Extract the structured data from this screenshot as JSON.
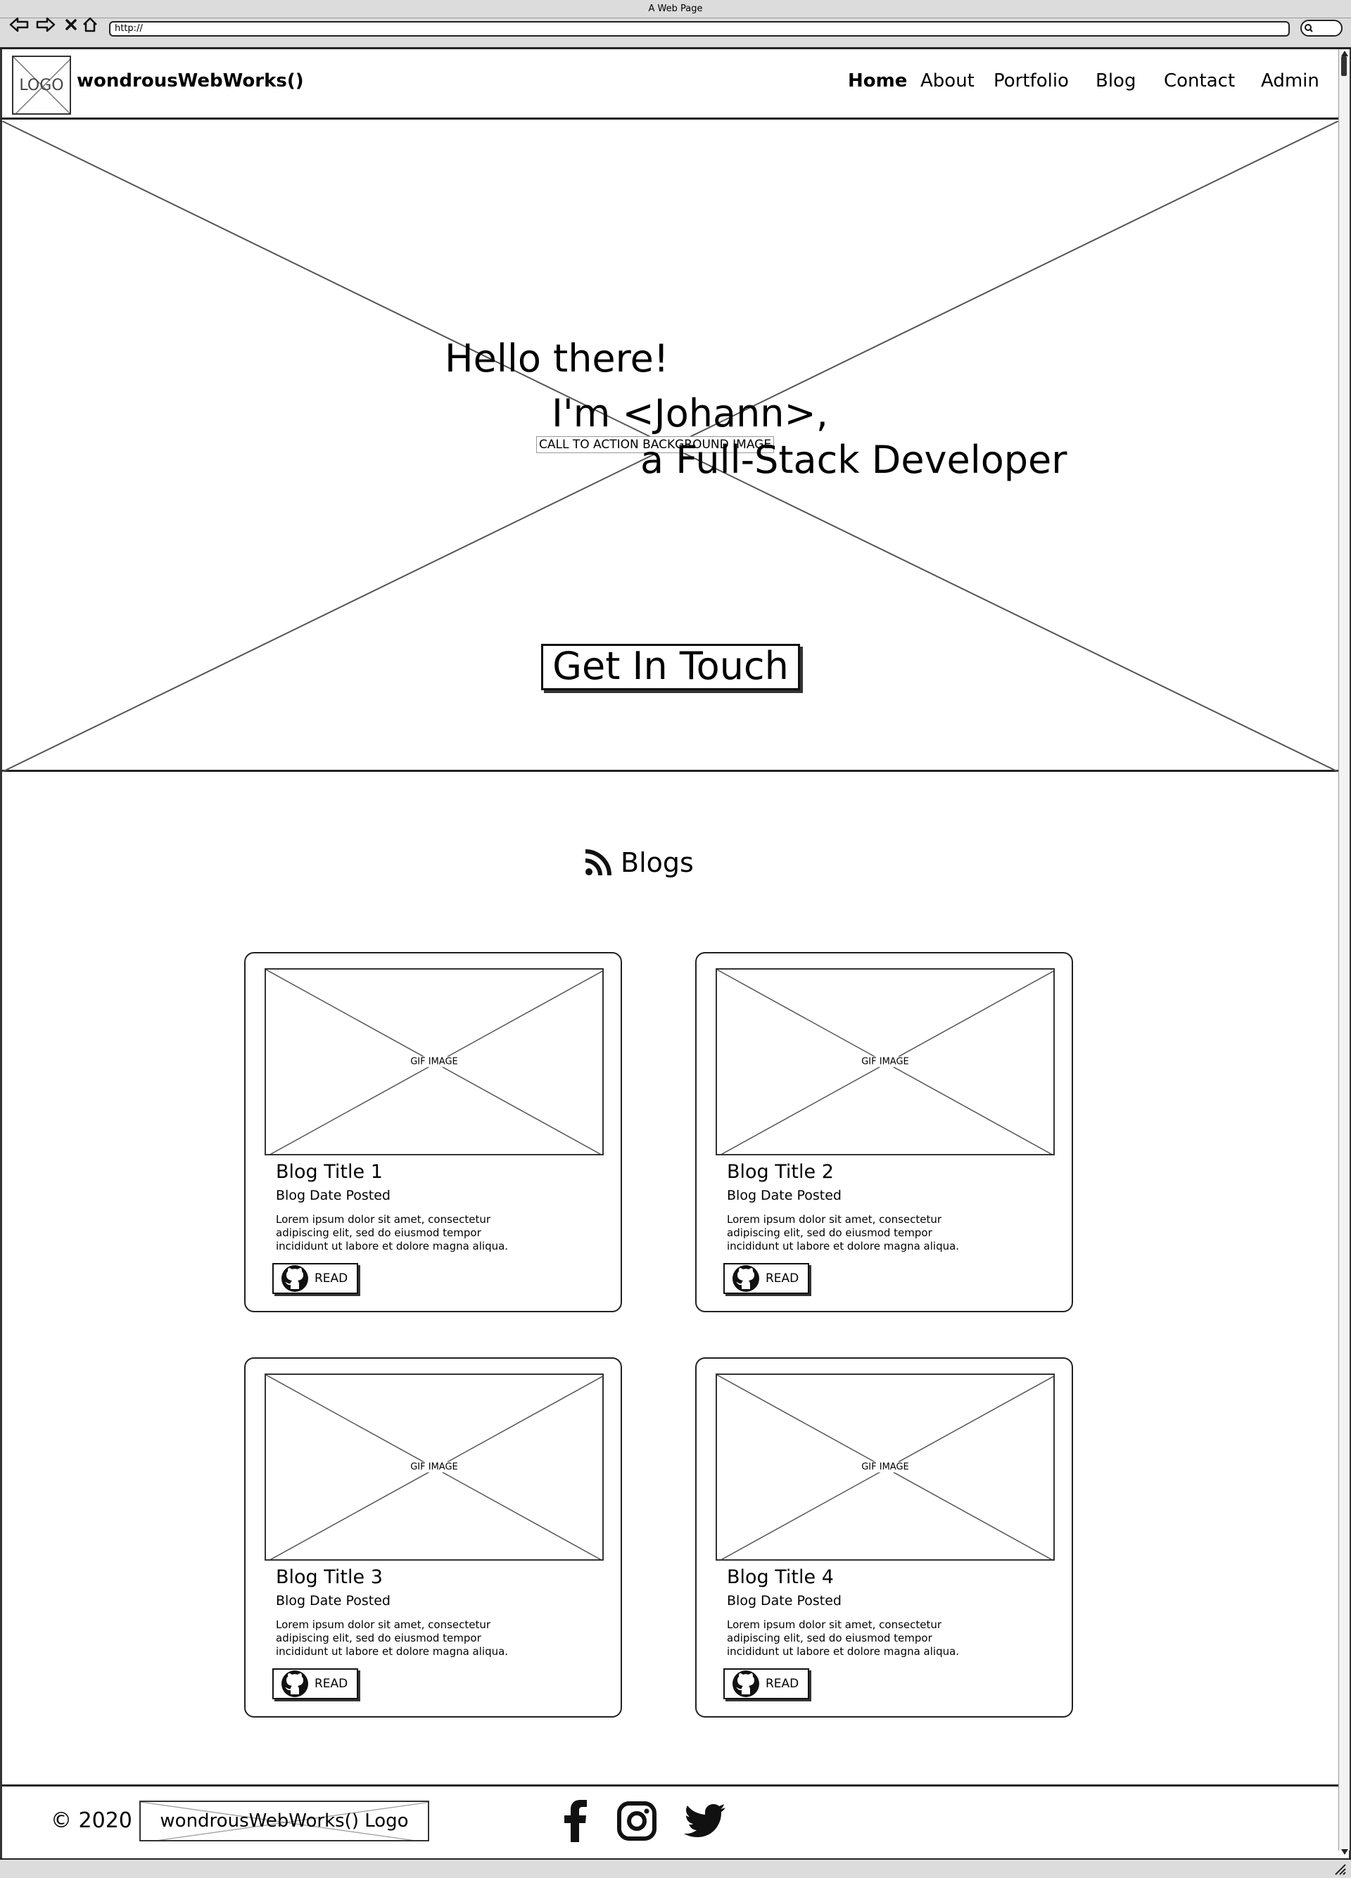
{
  "browser": {
    "window_title": "A Web Page",
    "url": "http://"
  },
  "header": {
    "logo_text": "LOGO",
    "brand": "wondrousWebWorks()",
    "nav": [
      {
        "label": "Home",
        "active": true
      },
      {
        "label": "About"
      },
      {
        "label": "Portfolio"
      },
      {
        "label": "Blog"
      },
      {
        "label": "Contact"
      },
      {
        "label": "Admin"
      }
    ]
  },
  "hero": {
    "image_label": "CALL TO ACTION BACKGROUND IMAGE",
    "greeting": "Hello there!",
    "intro": "I'm <Johann>,",
    "role": "a Full-Stack Developer",
    "cta_label": "Get In Touch"
  },
  "blogs": {
    "section_title": "Blogs",
    "section_icon": "rss-icon",
    "cards": [
      {
        "image_label": "GIF IMAGE",
        "title": "Blog Title 1",
        "date": "Blog Date Posted",
        "excerpt": "Lorem ipsum dolor sit amet, consectetur adipiscing elit, sed do eiusmod tempor incididunt ut labore et dolore magna aliqua.",
        "button_label": "READ",
        "button_icon": "github-icon"
      },
      {
        "image_label": "GIF IMAGE",
        "title": "Blog Title 2",
        "date": "Blog Date Posted",
        "excerpt": "Lorem ipsum dolor sit amet, consectetur adipiscing elit, sed do eiusmod tempor incididunt ut labore et dolore magna aliqua.",
        "button_label": "READ",
        "button_icon": "github-icon"
      },
      {
        "image_label": "GIF IMAGE",
        "title": "Blog Title 3",
        "date": "Blog Date Posted",
        "excerpt": "Lorem ipsum dolor sit amet, consectetur adipiscing elit, sed do eiusmod tempor incididunt ut labore et dolore magna aliqua.",
        "button_label": "READ",
        "button_icon": "github-icon"
      },
      {
        "image_label": "GIF IMAGE",
        "title": "Blog Title 4",
        "date": "Blog Date Posted",
        "excerpt": "Lorem ipsum dolor sit amet, consectetur adipiscing elit, sed do eiusmod tempor incididunt ut labore et dolore magna aliqua.",
        "button_label": "READ",
        "button_icon": "github-icon"
      }
    ]
  },
  "footer": {
    "copyright": "© 2020",
    "logo_label": "wondrousWebWorks() Logo",
    "social_icons": [
      "facebook-icon",
      "instagram-icon",
      "twitter-icon"
    ]
  }
}
